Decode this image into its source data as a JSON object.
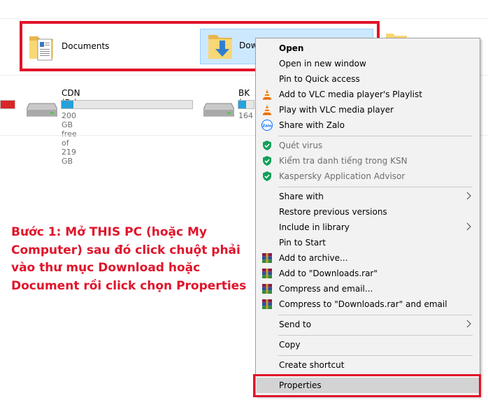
{
  "folders": {
    "documents_label": "Documents",
    "downloads_label": "Dow"
  },
  "drives": [
    {
      "name": "CDN (D:)",
      "free": "200 GB free of 219 GB",
      "used_fraction": 0.09
    },
    {
      "name": "BK (",
      "free": "164",
      "used_fraction": 0.5
    },
    {
      "name": "",
      "free": "",
      "used_fraction": 1.0
    }
  ],
  "instruction": {
    "line1": "Bước 1: Mở THIS PC (hoặc My",
    "line2": "Computer) sau đó click chuột phải",
    "line3": "vào thư mục Download hoặc",
    "line4": "Document rồi click chọn Properties"
  },
  "menu": {
    "open": "Open",
    "open_new_window": "Open in new window",
    "pin_quick_access": "Pin to Quick access",
    "vlc_playlist": "Add to VLC media player's Playlist",
    "vlc_play": "Play with VLC media player",
    "zalo_share": "Share with Zalo",
    "zalo_icon_text": "Zalo",
    "scan_virus": "Quét virus",
    "ksn_check": "Kiểm tra danh tiếng trong KSN",
    "kaspersky_advisor": "Kaspersky Application Advisor",
    "share_with": "Share with",
    "restore_versions": "Restore previous versions",
    "include_library": "Include in library",
    "pin_start": "Pin to Start",
    "add_archive": "Add to archive...",
    "add_downloads_rar": "Add to \"Downloads.rar\"",
    "compress_email": "Compress and email...",
    "compress_downloads_email": "Compress to \"Downloads.rar\" and email",
    "send_to": "Send to",
    "copy": "Copy",
    "create_shortcut": "Create shortcut",
    "properties": "Properties"
  },
  "colors": {
    "highlight_red": "#e0142a",
    "selection_blue": "#cce8ff",
    "drive_bar_blue": "#26a0da",
    "menu_background": "#f2f2f2"
  }
}
